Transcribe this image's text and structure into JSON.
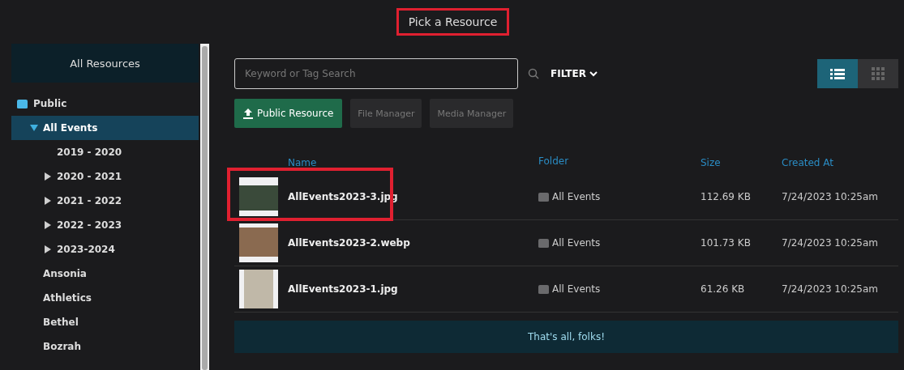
{
  "dialog": {
    "title": "Pick a Resource",
    "title_highlighted": true
  },
  "sidebar": {
    "header": "All Resources",
    "root": {
      "label": "Public",
      "children": [
        {
          "label": "All Events",
          "expandable": true,
          "expanded": true,
          "selected": true,
          "children": [
            {
              "label": "2019 - 2020",
              "expandable": false,
              "expanded": false,
              "selected": false
            },
            {
              "label": "2020 - 2021",
              "expandable": true,
              "expanded": false,
              "selected": false
            },
            {
              "label": "2021 - 2022",
              "expandable": true,
              "expanded": false,
              "selected": false
            },
            {
              "label": "2022 - 2023",
              "expandable": true,
              "expanded": false,
              "selected": false
            },
            {
              "label": "2023-2024",
              "expandable": true,
              "expanded": false,
              "selected": false
            }
          ]
        },
        {
          "label": "Ansonia",
          "expandable": false,
          "expanded": false,
          "selected": false
        },
        {
          "label": "Athletics",
          "expandable": false,
          "expanded": false,
          "selected": false
        },
        {
          "label": "Bethel",
          "expandable": false,
          "expanded": false,
          "selected": false
        },
        {
          "label": "Bozrah",
          "expandable": false,
          "expanded": false,
          "selected": false
        }
      ]
    }
  },
  "search": {
    "placeholder": "Keyword or Tag Search"
  },
  "filter": {
    "label": "FILTER"
  },
  "view_toggle": [
    {
      "kind": "list",
      "selected": true
    },
    {
      "kind": "grid",
      "selected": false
    }
  ],
  "actions": [
    {
      "label": "Public Resource",
      "kind": "upload",
      "disabled": false
    },
    {
      "label": "File Manager",
      "kind": "plain",
      "disabled": true
    },
    {
      "label": "Media Manager",
      "kind": "plain",
      "disabled": true
    }
  ],
  "table": {
    "columns": [
      "Name",
      "Folder",
      "Size",
      "Created At"
    ],
    "rows": [
      {
        "name": "AllEvents2023-3.jpg",
        "folder": "All Events",
        "size": "112.69 KB",
        "created_at": "7/24/2023 10:25am",
        "highlighted": true
      },
      {
        "name": "AllEvents2023-2.webp",
        "folder": "All Events",
        "size": "101.73 KB",
        "created_at": "7/24/2023 10:25am",
        "highlighted": false
      },
      {
        "name": "AllEvents2023-1.jpg",
        "folder": "All Events",
        "size": "61.26 KB",
        "created_at": "7/24/2023 10:25am",
        "highlighted": false
      }
    ]
  },
  "footer": "That's all, folks!"
}
